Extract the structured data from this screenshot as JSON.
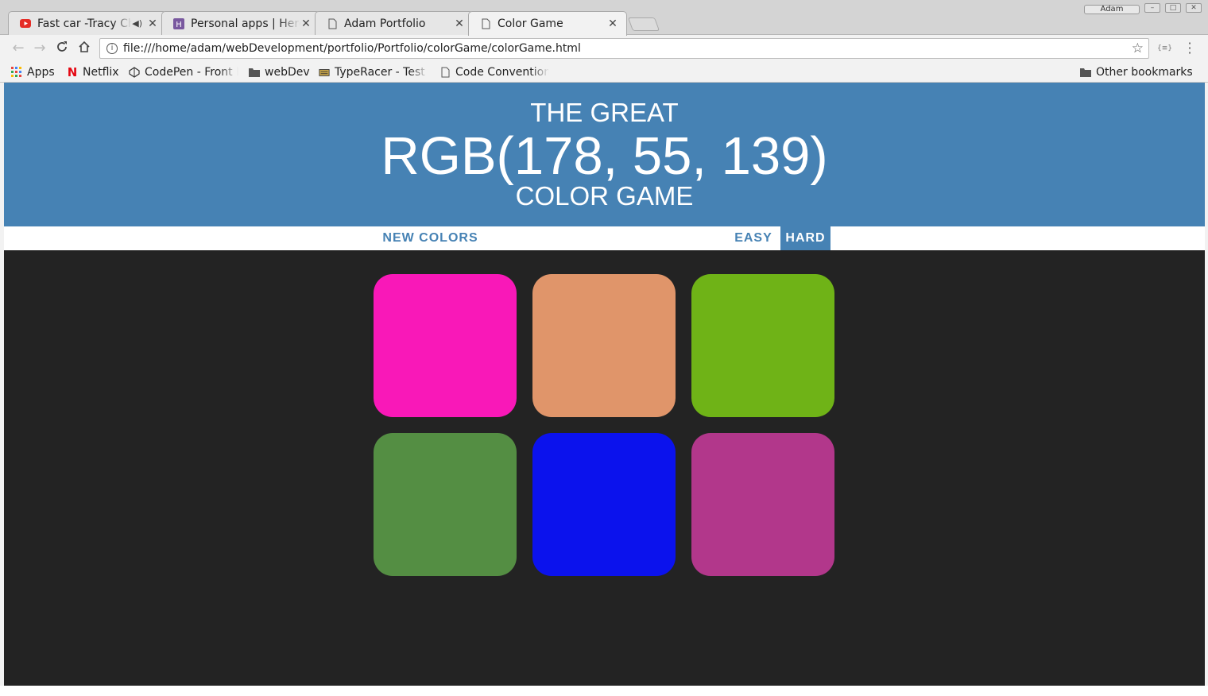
{
  "browser": {
    "tabs": [
      {
        "title": "Fast car -Tracy Chapman",
        "favicon": "youtube-icon",
        "audio": true
      },
      {
        "title": "Personal apps | Heroku",
        "favicon": "heroku-icon",
        "audio": false
      },
      {
        "title": "Adam Portfolio",
        "favicon": "page-icon",
        "audio": false
      },
      {
        "title": "Color Game",
        "favicon": "page-icon",
        "audio": false,
        "active": true
      }
    ],
    "profile_label": "Adam",
    "url": "file:///home/adam/webDevelopment/portfolio/Portfolio/colorGame/colorGame.html",
    "extension_label": "{≡}",
    "bookmarks": [
      {
        "label": "Apps",
        "icon": "apps-grid-icon"
      },
      {
        "label": "Netflix",
        "icon": "netflix-icon"
      },
      {
        "label": "CodePen - Front End",
        "icon": "codepen-icon"
      },
      {
        "label": "webDev",
        "icon": "folder-icon"
      },
      {
        "label": "TypeRacer - Test your",
        "icon": "typeracer-icon"
      },
      {
        "label": "Code Conventions",
        "icon": "page-icon"
      }
    ],
    "other_bookmarks": "Other bookmarks"
  },
  "game": {
    "header_top": "THE GREAT",
    "target_color": "RGB(178, 55, 139)",
    "header_bottom": "COLOR GAME",
    "header_bg": "#4682b4",
    "new_colors_label": "NEW COLORS",
    "easy_label": "EASY",
    "hard_label": "HARD",
    "selected_mode": "HARD",
    "message": "",
    "squares": [
      "#f918b8",
      "#e0956a",
      "#6fb317",
      "#548e43",
      "#0b12ed",
      "#b2378b"
    ]
  }
}
